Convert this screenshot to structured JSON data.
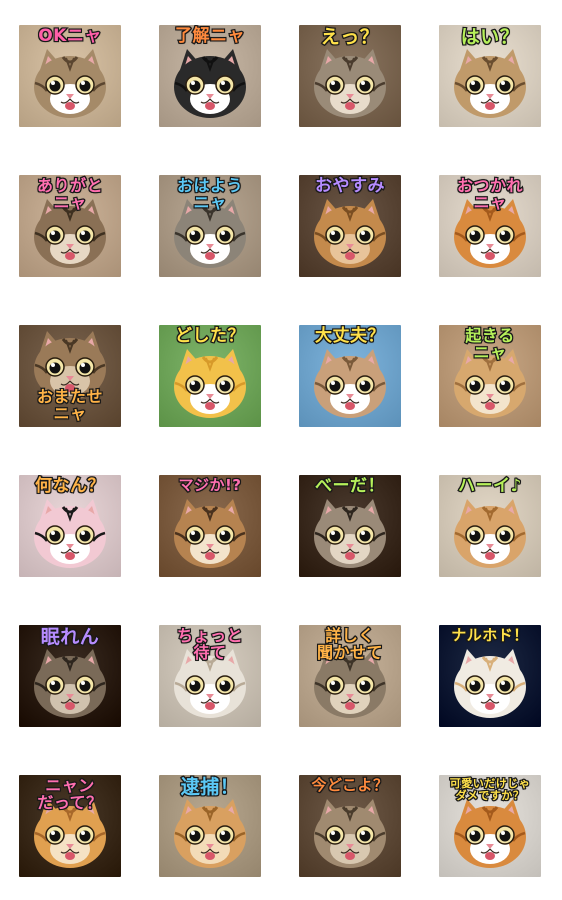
{
  "stickers": [
    {
      "caption": "OKニャ",
      "color": "#ff5fa8",
      "bg": "#d9c3a6",
      "fur": "#a58a68",
      "stripe": "#5b4630",
      "face": "#ffffff",
      "pos": "top"
    },
    {
      "caption": "了解ニャ",
      "color": "#ff8a3d",
      "bg": "#c8b8a6",
      "fur": "#2a2a2a",
      "stripe": "#111111",
      "face": "#ffffff",
      "pos": "top"
    },
    {
      "caption": "えっ？",
      "color": "#ffe14a",
      "bg": "#8a7560",
      "fur": "#9a8b78",
      "stripe": "#4a3c2e",
      "face": "#e8dccb",
      "pos": "top"
    },
    {
      "caption": "はい？",
      "color": "#b6f05a",
      "bg": "#e9dfd0",
      "fur": "#c09a6a",
      "stripe": "#6a4e30",
      "face": "#ffffff",
      "pos": "top"
    },
    {
      "caption": "ありがと\nニャ",
      "color": "#ff6fb0",
      "bg": "#cdb49a",
      "fur": "#8a7055",
      "stripe": "#3e3020",
      "face": "#e7d8c4",
      "pos": "top"
    },
    {
      "caption": "おはよう\nニャ",
      "color": "#5bc8f5",
      "bg": "#b9a894",
      "fur": "#8c8478",
      "stripe": "#3a342c",
      "face": "#ffffff",
      "pos": "top"
    },
    {
      "caption": "おやすみ",
      "color": "#b68cff",
      "bg": "#6a5646",
      "fur": "#c48a4c",
      "stripe": "#7a4e22",
      "face": "#e8c49a",
      "pos": "top"
    },
    {
      "caption": "おつかれ\nニャ",
      "color": "#ff6fb0",
      "bg": "#e6dccf",
      "fur": "#d98a3e",
      "stripe": "#a45a1c",
      "face": "#ffffff",
      "pos": "top"
    },
    {
      "caption": "おまたせ\nニャ",
      "color": "#ffb347",
      "bg": "#7b6550",
      "fur": "#9a7a58",
      "stripe": "#4a3825",
      "face": "#d9c4a8",
      "pos": "bottom"
    },
    {
      "caption": "どした？",
      "color": "#ffe14a",
      "bg": "#7fb56a",
      "fur": "#f2c14a",
      "stripe": "#d79a2a",
      "face": "#ffffff",
      "pos": "top"
    },
    {
      "caption": "大丈夫？",
      "color": "#ffe14a",
      "bg": "#7fb4dc",
      "fur": "#c9a07a",
      "stripe": "#7a5a3a",
      "face": "#ffffff",
      "pos": "top"
    },
    {
      "caption": "起きる\nニャ",
      "color": "#b6f05a",
      "bg": "#c9a886",
      "fur": "#d7a86e",
      "stripe": "#a0703e",
      "face": "#f3e4cc",
      "pos": "top"
    },
    {
      "caption": "何なん？",
      "color": "#ffb347",
      "bg": "#e9d6d8",
      "fur": "#f2c9d3",
      "stripe": "#1a1a1a",
      "face": "#ffffff",
      "pos": "top"
    },
    {
      "caption": "マジか!?",
      "color": "#ff6fb0",
      "bg": "#8a6a4e",
      "fur": "#b68350",
      "stripe": "#4a321e",
      "face": "#f3e4cc",
      "pos": "top"
    },
    {
      "caption": "べーだ！",
      "color": "#b6f05a",
      "bg": "#4a3a2e",
      "fur": "#9a8a78",
      "stripe": "#2e261e",
      "face": "#e3d6c4",
      "pos": "top"
    },
    {
      "caption": "ハーイ♪",
      "color": "#b6f05a",
      "bg": "#e2d7c6",
      "fur": "#d9a46a",
      "stripe": "#a26a30",
      "face": "#ffffff",
      "pos": "top"
    },
    {
      "caption": "眠れん",
      "color": "#b68cff",
      "bg": "#3a2c22",
      "fur": "#7a6a58",
      "stripe": "#2e261e",
      "face": "#d0c2ae",
      "pos": "top"
    },
    {
      "caption": "ちょっと\n待て",
      "color": "#ff6fb0",
      "bg": "#d8cfc2",
      "fur": "#e8e2d8",
      "stripe": "#b8aa96",
      "face": "#ffffff",
      "pos": "top"
    },
    {
      "caption": "詳しく\n聞かせて",
      "color": "#ffb347",
      "bg": "#c8b49c",
      "fur": "#8a7a66",
      "stripe": "#3e3428",
      "face": "#e0d2bc",
      "pos": "top"
    },
    {
      "caption": "ナルホド！",
      "color": "#ffe14a",
      "bg": "#1e2a44",
      "fur": "#f0ebe2",
      "stripe": "#d8b07a",
      "face": "#ffffff",
      "pos": "top"
    },
    {
      "caption": "ニャン\nだって？",
      "color": "#ff6fb0",
      "bg": "#4a3a2a",
      "fur": "#e0a050",
      "stripe": "#a8682a",
      "face": "#f5e2c4",
      "pos": "top"
    },
    {
      "caption": "逮捕！",
      "color": "#5bc8f5",
      "bg": "#b8a890",
      "fur": "#d9a060",
      "stripe": "#9a6428",
      "face": "#f3dcb8",
      "pos": "top"
    },
    {
      "caption": "今どこよ？",
      "color": "#ff8a3d",
      "bg": "#6e5a48",
      "fur": "#a08a70",
      "stripe": "#4a3c2c",
      "face": "#d8c8b0",
      "pos": "top"
    },
    {
      "caption": "可愛いだけじゃ\nダメですか？",
      "color": "#ffe14a",
      "bg": "#e6e2dc",
      "fur": "#d98a3e",
      "stripe": "#a45a1c",
      "face": "#ffffff",
      "pos": "top"
    }
  ]
}
